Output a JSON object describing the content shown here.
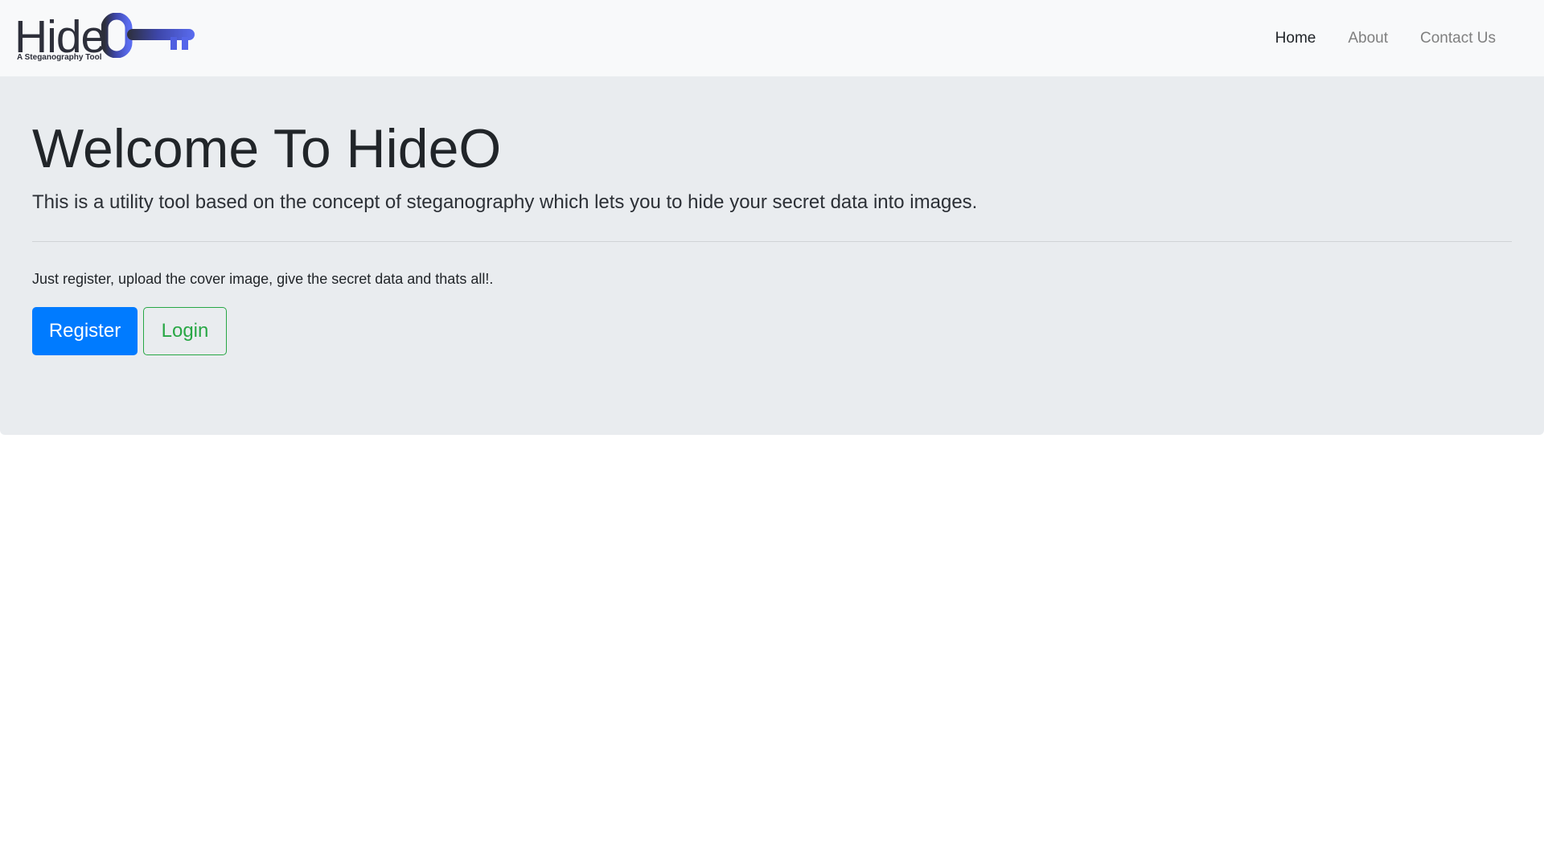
{
  "navbar": {
    "brand": {
      "name": "HideO",
      "name_prefix": "Hide",
      "tagline": "A Steganography Tool",
      "icon": "key-icon",
      "icon_colors": [
        "#2d2f3a",
        "#4b5bd6",
        "#5a6cf0"
      ]
    },
    "links": [
      {
        "label": "Home",
        "active": true
      },
      {
        "label": "About",
        "active": false
      },
      {
        "label": "Contact Us",
        "active": false
      }
    ]
  },
  "jumbotron": {
    "title": "Welcome To HideO",
    "lead": "This is a utility tool based on the concept of steganography which lets you to hide your secret data into images.",
    "body": "Just register, upload the cover image, give the secret data and thats all!.",
    "buttons": {
      "register_label": "Register",
      "login_label": "Login"
    }
  },
  "colors": {
    "navbar_bg": "#f8f9fa",
    "jumbotron_bg": "#e9ecef",
    "primary": "#007bff",
    "success": "#28a745",
    "text": "#212529",
    "nav_muted": "#7f7f7f"
  }
}
